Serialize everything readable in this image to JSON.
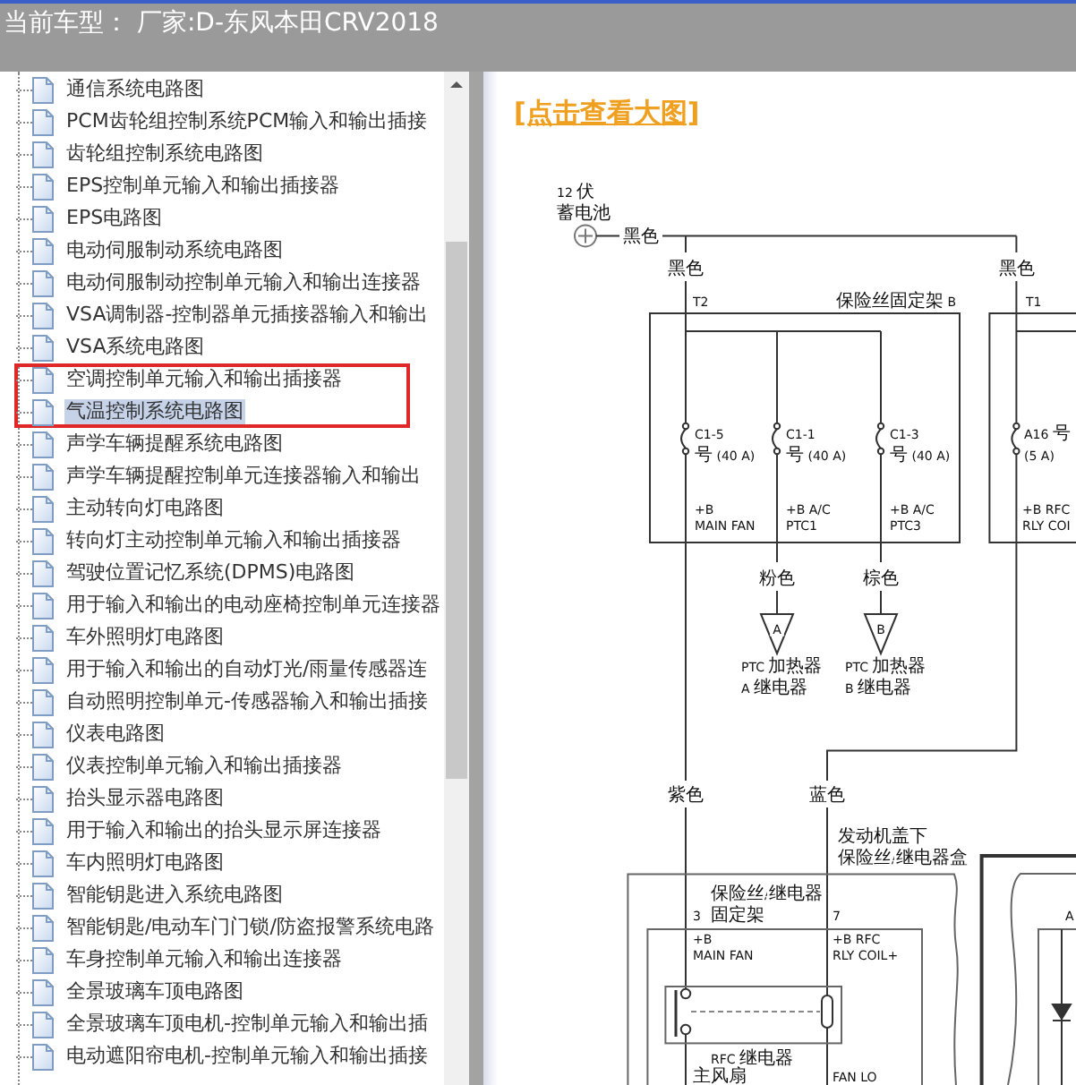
{
  "header": {
    "title": "当前车型： 厂家:D-东风本田CRV2018"
  },
  "tree": {
    "items": [
      {
        "label": "通信系统电路图",
        "selected": false,
        "outlined": false
      },
      {
        "label": "PCM齿轮组控制系统PCM输入和输出插接",
        "selected": false,
        "outlined": false
      },
      {
        "label": "齿轮组控制系统电路图",
        "selected": false,
        "outlined": false
      },
      {
        "label": "EPS控制单元输入和输出插接器",
        "selected": false,
        "outlined": false
      },
      {
        "label": "EPS电路图",
        "selected": false,
        "outlined": false
      },
      {
        "label": "电动伺服制动系统电路图",
        "selected": false,
        "outlined": false
      },
      {
        "label": "电动伺服制动控制单元输入和输出连接器",
        "selected": false,
        "outlined": false
      },
      {
        "label": "VSA调制器-控制器单元插接器输入和输出",
        "selected": false,
        "outlined": false
      },
      {
        "label": "VSA系统电路图",
        "selected": false,
        "outlined": false
      },
      {
        "label": "空调控制单元输入和输出插接器",
        "selected": false,
        "outlined": true
      },
      {
        "label": "气温控制系统电路图",
        "selected": true,
        "outlined": true
      },
      {
        "label": "声学车辆提醒系统电路图",
        "selected": false,
        "outlined": false
      },
      {
        "label": "声学车辆提醒控制单元连接器输入和输出",
        "selected": false,
        "outlined": false
      },
      {
        "label": "主动转向灯电路图",
        "selected": false,
        "outlined": false
      },
      {
        "label": "转向灯主动控制单元输入和输出插接器",
        "selected": false,
        "outlined": false
      },
      {
        "label": "驾驶位置记忆系统(DPMS)电路图",
        "selected": false,
        "outlined": false
      },
      {
        "label": "用于输入和输出的电动座椅控制单元连接器",
        "selected": false,
        "outlined": false
      },
      {
        "label": "车外照明灯电路图",
        "selected": false,
        "outlined": false
      },
      {
        "label": "用于输入和输出的自动灯光/雨量传感器连",
        "selected": false,
        "outlined": false
      },
      {
        "label": "自动照明控制单元-传感器输入和输出插接",
        "selected": false,
        "outlined": false
      },
      {
        "label": "仪表电路图",
        "selected": false,
        "outlined": false
      },
      {
        "label": "仪表控制单元输入和输出插接器",
        "selected": false,
        "outlined": false
      },
      {
        "label": "抬头显示器电路图",
        "selected": false,
        "outlined": false
      },
      {
        "label": "用于输入和输出的抬头显示屏连接器",
        "selected": false,
        "outlined": false
      },
      {
        "label": "车内照明灯电路图",
        "selected": false,
        "outlined": false
      },
      {
        "label": "智能钥匙进入系统电路图",
        "selected": false,
        "outlined": false
      },
      {
        "label": "智能钥匙/电动车门门锁/防盗报警系统电路",
        "selected": false,
        "outlined": false
      },
      {
        "label": "车身控制单元输入和输出连接器",
        "selected": false,
        "outlined": false
      },
      {
        "label": "全景玻璃车顶电路图",
        "selected": false,
        "outlined": false
      },
      {
        "label": "全景玻璃车顶电机-控制单元输入和输出插",
        "selected": false,
        "outlined": false
      },
      {
        "label": "电动遮阳帘电机-控制单元输入和输出插接",
        "selected": false,
        "outlined": false
      }
    ]
  },
  "diagram": {
    "link": "[点击查看大图]",
    "labels": [
      "12 伏",
      "蓄电池",
      "黑色",
      "黑色",
      "T2",
      "保险丝固定架 B",
      "黑色",
      "T1",
      "C1-5",
      "号 (40 A)",
      "C1-1",
      "号 (40 A)",
      "C1-3",
      "号 (40 A)",
      "A16 号",
      "(5 A)",
      "+B",
      "MAIN FAN",
      "+B A/C",
      "PTC1",
      "+B A/C",
      "PTC3",
      "+B RFC",
      "RLY COI",
      "粉色",
      "棕色",
      "A",
      "B",
      "PTC 加热器",
      "A 继电器",
      "PTC 加热器",
      "B 继电器",
      "紫色",
      "蓝色",
      "发动机盖下",
      "保险丝/继电器盒",
      "保险丝/继电器",
      "3",
      "固定架",
      "7",
      "+B",
      "MAIN FAN",
      "+B RFC",
      "RLY COIL+",
      "RFC 继电器",
      "主风扇",
      "FAN LO",
      "A"
    ]
  }
}
